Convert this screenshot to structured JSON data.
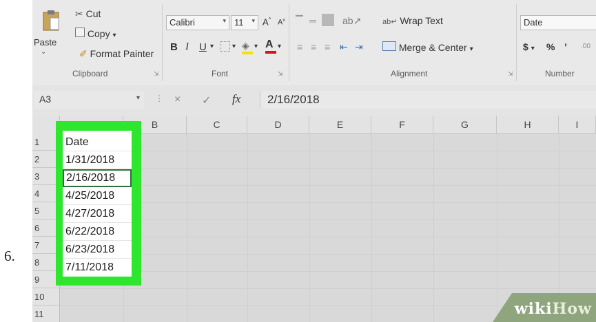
{
  "step_number": "6.",
  "ribbon": {
    "clipboard": {
      "paste_label": "Paste",
      "cut_label": "Cut",
      "copy_label": "Copy",
      "copy_dropdown": "▾",
      "format_painter_label": "Format Painter",
      "group_label": "Clipboard"
    },
    "font": {
      "font_name": "Calibri",
      "font_size": "11",
      "increase_font": "A",
      "decrease_font": "A",
      "bold": "B",
      "italic": "I",
      "underline": "U",
      "font_color_letter": "A",
      "group_label": "Font"
    },
    "alignment": {
      "wrap_text_label": "Wrap Text",
      "merge_center_label": "Merge & Center",
      "group_label": "Alignment"
    },
    "number": {
      "format_value": "Date",
      "currency": "$",
      "percent": "%",
      "comma": "’",
      "group_label": "Number"
    }
  },
  "formula_bar": {
    "name_box": "A3",
    "cancel": "×",
    "enter": "✓",
    "fx": "fx",
    "value": "2/16/2018"
  },
  "grid": {
    "columns": [
      "B",
      "C",
      "D",
      "E",
      "F",
      "G",
      "H",
      "I"
    ],
    "rows": [
      "1",
      "2",
      "3",
      "4",
      "5",
      "6",
      "7",
      "8",
      "9",
      "10",
      "11"
    ],
    "column_a_cells": [
      "Date",
      "1/31/2018",
      "2/16/2018",
      "4/25/2018",
      "4/27/2018",
      "6/22/2018",
      "6/23/2018",
      "7/11/2018"
    ],
    "active_cell_index": 2
  },
  "watermark": {
    "part1": "wiki",
    "part2": "How"
  },
  "colors": {
    "highlight": "#2de62d",
    "active_cell_border": "#2f6f3a",
    "font_color_bar": "#d01818",
    "fill_color_bar": "#f2e200"
  }
}
